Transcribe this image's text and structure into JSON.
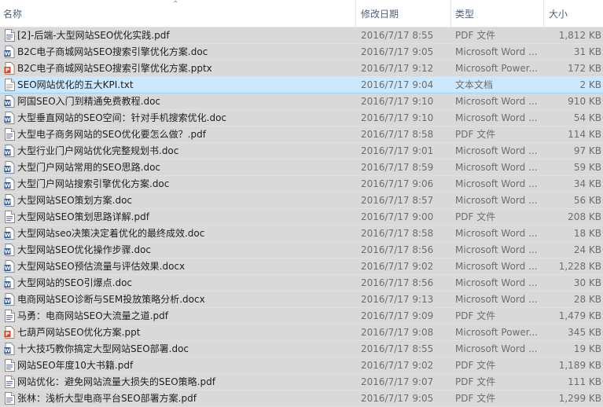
{
  "columns": {
    "name": "名称",
    "date": "修改日期",
    "type": "类型",
    "size": "大小"
  },
  "files": [
    {
      "name": "[2]-后端-大型网站SEO优化实践.pdf",
      "date": "2016/7/17 8:55",
      "type": "PDF 文件",
      "size": "1,812 KB",
      "icon": "pdf-file-icon"
    },
    {
      "name": "B2C电子商城网站SEO搜索引擎优化方案.doc",
      "date": "2016/7/17 9:05",
      "type": "Microsoft Word ...",
      "size": "31 KB",
      "icon": "word-file-icon"
    },
    {
      "name": "B2C电子商城网站SEO搜索引擎优化方案.pptx",
      "date": "2016/7/17 9:12",
      "type": "Microsoft Power...",
      "size": "172 KB",
      "icon": "powerpoint-file-icon"
    },
    {
      "name": "SEO网站优化的五大KPI.txt",
      "date": "2016/7/17 9:04",
      "type": "文本文档",
      "size": "2 KB",
      "icon": "text-file-icon",
      "selected": true
    },
    {
      "name": "阿国SEO入门到精通免费教程.doc",
      "date": "2016/7/17 9:10",
      "type": "Microsoft Word ...",
      "size": "910 KB",
      "icon": "word-file-icon"
    },
    {
      "name": "大型垂直网站的SEO空间：针对手机搜索优化.doc",
      "date": "2016/7/17 9:10",
      "type": "Microsoft Word ...",
      "size": "54 KB",
      "icon": "word-file-icon"
    },
    {
      "name": "大型电子商务网站的SEO优化要怎么做？.pdf",
      "date": "2016/7/17 8:58",
      "type": "PDF 文件",
      "size": "114 KB",
      "icon": "pdf-file-icon"
    },
    {
      "name": "大型行业门户网站优化完整规划书.doc",
      "date": "2016/7/17 9:01",
      "type": "Microsoft Word ...",
      "size": "97 KB",
      "icon": "word-file-icon"
    },
    {
      "name": "大型门户网站常用的SEO思路.doc",
      "date": "2016/7/17 8:59",
      "type": "Microsoft Word ...",
      "size": "59 KB",
      "icon": "word-file-icon"
    },
    {
      "name": "大型门户网站搜索引擎优化方案.doc",
      "date": "2016/7/17 9:06",
      "type": "Microsoft Word ...",
      "size": "34 KB",
      "icon": "word-file-icon"
    },
    {
      "name": "大型网站SEO策划方案.doc",
      "date": "2016/7/17 8:57",
      "type": "Microsoft Word ...",
      "size": "56 KB",
      "icon": "word-file-icon"
    },
    {
      "name": "大型网站SEO策划思路详解.pdf",
      "date": "2016/7/17 9:00",
      "type": "PDF 文件",
      "size": "208 KB",
      "icon": "pdf-file-icon"
    },
    {
      "name": "大型网站seo决策决定着优化的最终成效.doc",
      "date": "2016/7/17 8:58",
      "type": "Microsoft Word ...",
      "size": "18 KB",
      "icon": "word-file-icon"
    },
    {
      "name": "大型网站SEO优化操作步骤.doc",
      "date": "2016/7/17 8:56",
      "type": "Microsoft Word ...",
      "size": "24 KB",
      "icon": "word-file-icon"
    },
    {
      "name": "大型网站SEO预估流量与评估效果.docx",
      "date": "2016/7/17 9:02",
      "type": "Microsoft Word ...",
      "size": "1,228 KB",
      "icon": "word-file-icon"
    },
    {
      "name": "大型网站的SEO引爆点.doc",
      "date": "2016/7/17 8:56",
      "type": "Microsoft Word ...",
      "size": "30 KB",
      "icon": "word-file-icon"
    },
    {
      "name": "电商网站SEO诊断与SEM投放策略分析.docx",
      "date": "2016/7/17 9:13",
      "type": "Microsoft Word ...",
      "size": "28 KB",
      "icon": "word-file-icon"
    },
    {
      "name": "马勇：电商网站SEO大流量之道.pdf",
      "date": "2016/7/17 9:09",
      "type": "PDF 文件",
      "size": "1,479 KB",
      "icon": "pdf-file-icon"
    },
    {
      "name": "七葫芦网站SEO优化方案.ppt",
      "date": "2016/7/17 9:08",
      "type": "Microsoft Power...",
      "size": "345 KB",
      "icon": "powerpoint-file-icon"
    },
    {
      "name": "十大技巧教你搞定大型网站SEO部署.doc",
      "date": "2016/7/17 8:55",
      "type": "Microsoft Word ...",
      "size": "19 KB",
      "icon": "word-file-icon"
    },
    {
      "name": "网站SEO年度10大书籍.pdf",
      "date": "2016/7/17 9:02",
      "type": "PDF 文件",
      "size": "1,189 KB",
      "icon": "pdf-file-icon"
    },
    {
      "name": "网站优化：避免网站流量大损失的SEO策略.pdf",
      "date": "2016/7/17 9:07",
      "type": "PDF 文件",
      "size": "111 KB",
      "icon": "pdf-file-icon"
    },
    {
      "name": "张林：浅析大型电商平台SEO部署方案.pdf",
      "date": "2016/7/17 9:05",
      "type": "PDF 文件",
      "size": "1,299 KB",
      "icon": "pdf-file-icon"
    }
  ]
}
